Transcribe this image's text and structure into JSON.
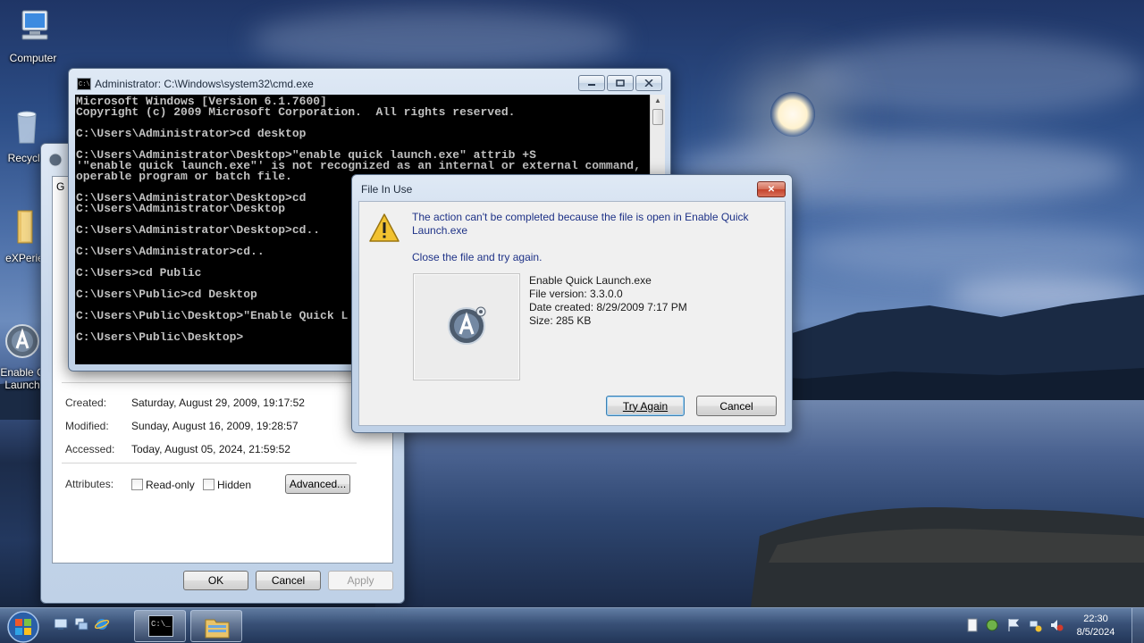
{
  "desktop": {
    "icons": [
      {
        "label": "Computer"
      },
      {
        "label": "Recycle"
      },
      {
        "label": "eXPerie"
      },
      {
        "label": "Enable C\nLaunch"
      }
    ]
  },
  "properties_dialog": {
    "tab_fragment": "G",
    "created_label": "Created:",
    "created_value": "Saturday, August 29, 2009, 19:17:52",
    "modified_label": "Modified:",
    "modified_value": "Sunday, August 16, 2009, 19:28:57",
    "accessed_label": "Accessed:",
    "accessed_value": "Today, August 05, 2024, 21:59:52",
    "attributes_label": "Attributes:",
    "readonly_label": "Read-only",
    "hidden_label": "Hidden",
    "advanced_label": "Advanced...",
    "ok_label": "OK",
    "cancel_label": "Cancel",
    "apply_label": "Apply"
  },
  "cmd_window": {
    "title": "Administrator: C:\\Windows\\system32\\cmd.exe",
    "lines": [
      "Microsoft Windows [Version 6.1.7600]",
      "Copyright (c) 2009 Microsoft Corporation.  All rights reserved.",
      "",
      "C:\\Users\\Administrator>cd desktop",
      "",
      "C:\\Users\\Administrator\\Desktop>\"enable quick launch.exe\" attrib +S",
      "'\"enable quick launch.exe\"' is not recognized as an internal or external command,",
      "operable program or batch file.",
      "",
      "C:\\Users\\Administrator\\Desktop>cd",
      "C:\\Users\\Administrator\\Desktop",
      "",
      "C:\\Users\\Administrator\\Desktop>cd..",
      "",
      "C:\\Users\\Administrator>cd..",
      "",
      "C:\\Users>cd Public",
      "",
      "C:\\Users\\Public>cd Desktop",
      "",
      "C:\\Users\\Public\\Desktop>\"Enable Quick L",
      "",
      "C:\\Users\\Public\\Desktop>"
    ]
  },
  "file_in_use_dialog": {
    "title": "File In Use",
    "message": "The action can't be completed because the file is open in Enable Quick Launch.exe",
    "instruction": "Close the file and try again.",
    "file_name": "Enable Quick Launch.exe",
    "file_version": "File version: 3.3.0.0",
    "date_created": "Date created: 8/29/2009 7:17 PM",
    "size": "Size: 285 KB",
    "try_again_label": "Try Again",
    "cancel_label": "Cancel",
    "close_glyph": "✕"
  },
  "taskbar": {
    "time": "22:30",
    "date": "8/5/2024"
  },
  "icons": {
    "warning": "warning-icon",
    "app": "enable-quick-launch-icon",
    "start": "start-orb-icon"
  }
}
